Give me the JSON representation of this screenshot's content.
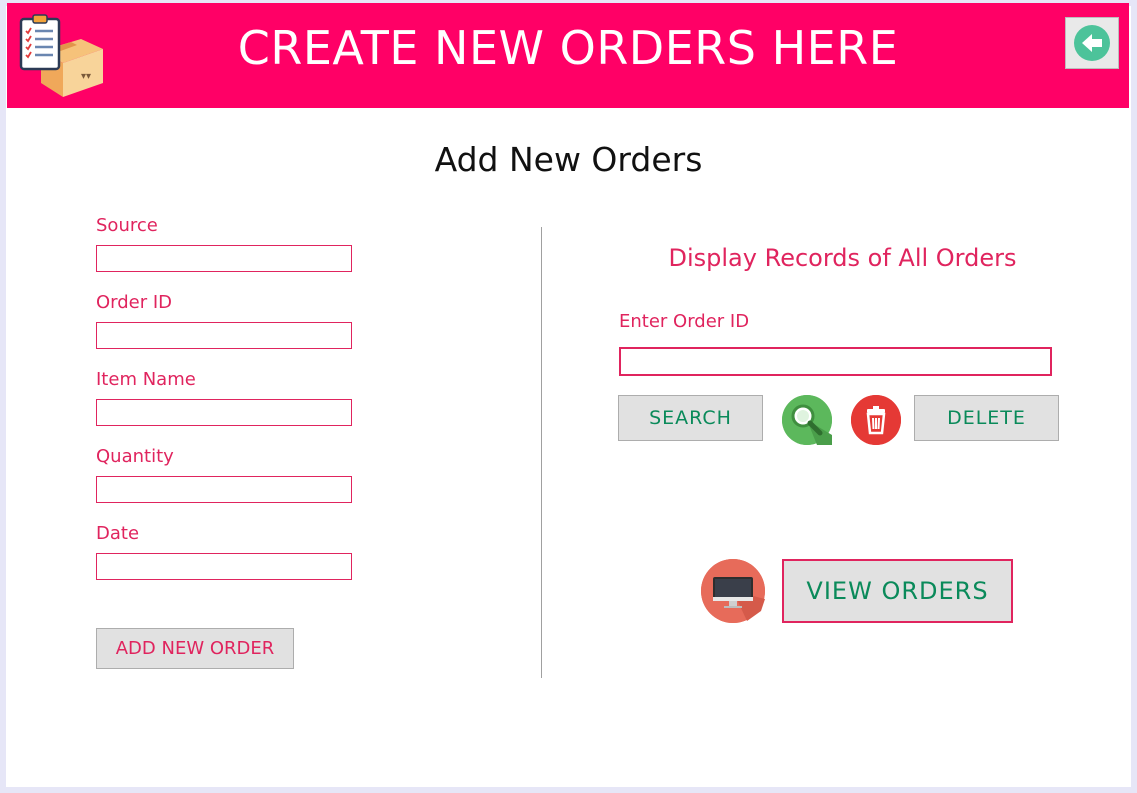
{
  "header": {
    "title": "CREATE NEW ORDERS HERE"
  },
  "page": {
    "title": "Add New Orders"
  },
  "form": {
    "source_label": "Source",
    "source_value": "",
    "order_id_label": "Order ID",
    "order_id_value": "",
    "item_name_label": "Item Name",
    "item_name_value": "",
    "quantity_label": "Quantity",
    "quantity_value": "",
    "date_label": "Date",
    "date_value": "",
    "add_button_label": "ADD NEW ORDER"
  },
  "records": {
    "title": "Display Records of All Orders",
    "order_id_label": "Enter Order ID",
    "order_id_value": "",
    "search_label": "SEARCH",
    "delete_label": "DELETE",
    "view_orders_label": "VIEW ORDERS"
  },
  "colors": {
    "header_bg": "#ff0066",
    "label_text": "#e0245e",
    "action_text": "#0a8a5a",
    "button_bg": "#e1e1e1"
  },
  "icons": {
    "logo": "order-box-clipboard-icon",
    "back": "back-arrow-icon",
    "search": "magnifier-icon",
    "delete": "trash-icon",
    "view": "monitor-icon"
  }
}
